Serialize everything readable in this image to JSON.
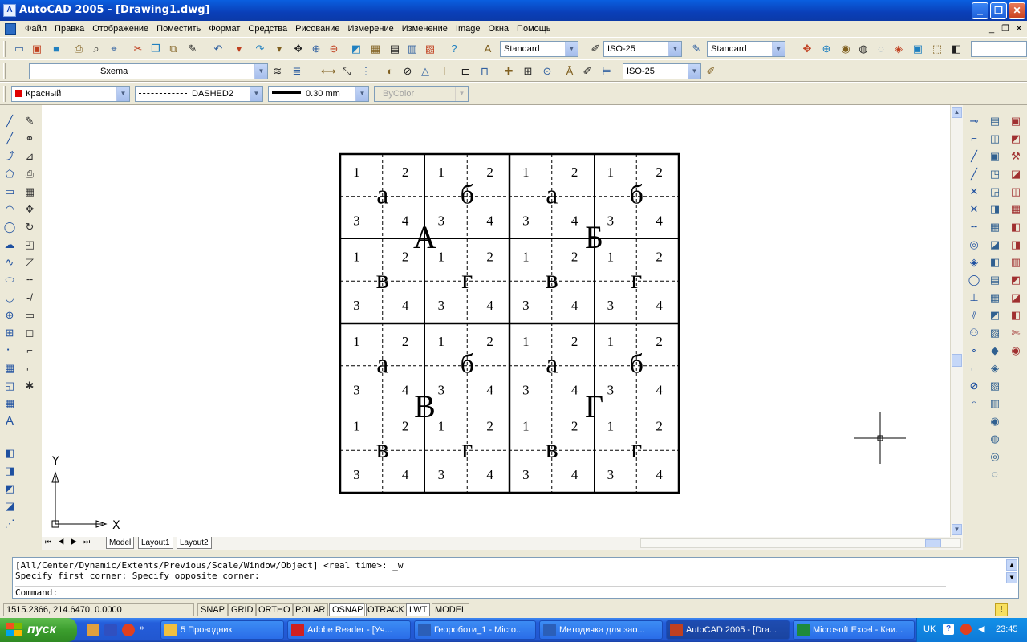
{
  "window": {
    "title": "AutoCAD 2005 - [Drawing1.dwg]",
    "app_icon_text": "A"
  },
  "menu": {
    "items": [
      "Файл",
      "Правка",
      "Отображение",
      "Поместить",
      "Формат",
      "Средства",
      "Рисование",
      "Измерение",
      "Изменение",
      "Image",
      "Окна",
      "Помощь"
    ]
  },
  "toolbars": {
    "text_style": "Standard",
    "dim_style": "ISO-25",
    "table_style": "Standard",
    "layer": "Sxema",
    "dim_style_2": "ISO-25",
    "color": "Красный",
    "color_hex": "#E00000",
    "linetype": "DASHED2",
    "lineweight": "0.30 mm",
    "plotstyle": "ByColor"
  },
  "drawing": {
    "big_labels": [
      "А",
      "Б",
      "В",
      "Г"
    ],
    "mid_labels": [
      "а",
      "б",
      "в",
      "г"
    ],
    "cell_numbers": [
      "1",
      "2",
      "3",
      "4"
    ],
    "ucs_x": "X",
    "ucs_y": "Y"
  },
  "tabs": [
    "Model",
    "Layout1",
    "Layout2"
  ],
  "command": {
    "line1": "[All/Center/Dynamic/Extents/Previous/Scale/Window/Object] <real time>: _w",
    "line2": "Specify first corner: Specify opposite corner:",
    "line3": "Command:"
  },
  "status": {
    "coords": "1515.2366, 214.6470, 0.0000",
    "buttons": [
      {
        "label": "SNAP",
        "on": false
      },
      {
        "label": "GRID",
        "on": false
      },
      {
        "label": "ORTHO",
        "on": false
      },
      {
        "label": "POLAR",
        "on": false
      },
      {
        "label": "OSNAP",
        "on": true
      },
      {
        "label": "OTRACK",
        "on": false
      },
      {
        "label": "LWT",
        "on": true
      },
      {
        "label": "MODEL",
        "on": false
      }
    ]
  },
  "taskbar": {
    "start_label": "пуск",
    "tasks": [
      {
        "label": "5 Проводник",
        "icon_color": "#F0C040"
      },
      {
        "label": "Adobe Reader - [Уч...",
        "icon_color": "#D02020"
      },
      {
        "label": "Геороботи_1 - Micro...",
        "icon_color": "#2B5FB8"
      },
      {
        "label": "Методичка для зао...",
        "icon_color": "#2B5FB8"
      },
      {
        "label": "AutoCAD 2005 - [Dra...",
        "icon_color": "#C04020"
      },
      {
        "label": "Microsoft Excel - Кни...",
        "icon_color": "#1E8A3C"
      }
    ],
    "lang": "UK",
    "clock": "23:45"
  }
}
